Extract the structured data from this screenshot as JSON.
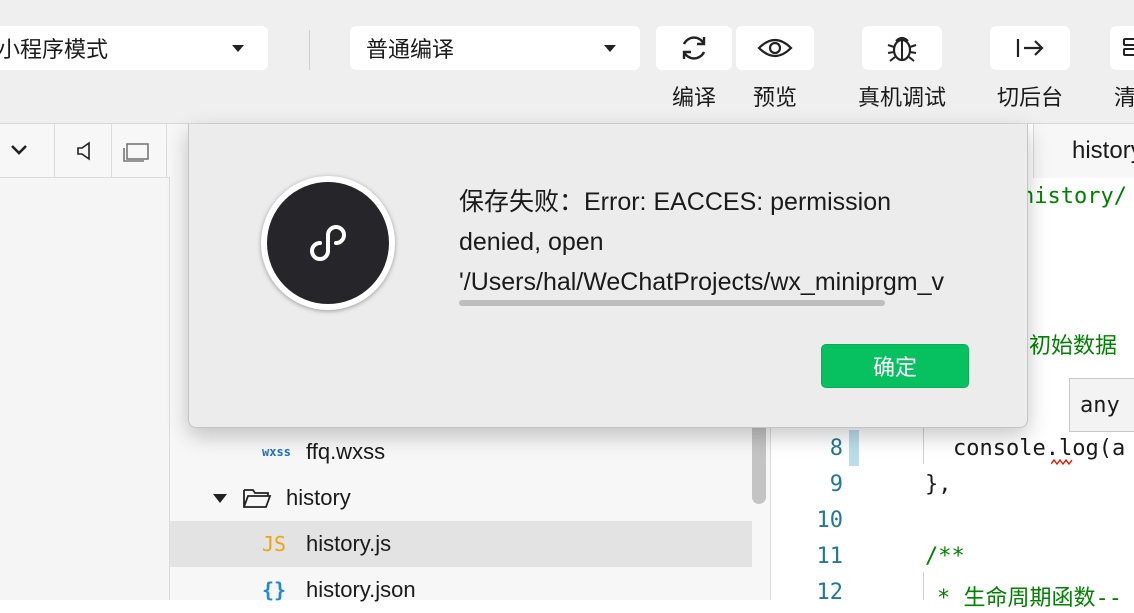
{
  "toolbar": {
    "mode_value": "小程序模式",
    "compile_value": "普通编译",
    "buttons": {
      "compile_label": "编译",
      "preview_label": "预览",
      "remote_debug_label": "真机调试",
      "background_label": "切后台",
      "clear_label": "清"
    }
  },
  "tree": {
    "items": [
      {
        "icon_text": "wxss",
        "label": "ffq.wxss"
      },
      {
        "label": "history"
      },
      {
        "icon_text": "JS",
        "label": "history.js"
      },
      {
        "icon_text": "{}",
        "label": "history.json"
      }
    ]
  },
  "editor": {
    "tab_label": "history",
    "lines": [
      {
        "text": "history/"
      },
      {
        "text": "的初始数据"
      },
      {
        "text": "any"
      },
      {
        "num": "8",
        "text": "console.log(a"
      },
      {
        "num": "9",
        "text": "},"
      },
      {
        "num": "10",
        "text": ""
      },
      {
        "num": "11",
        "text": "/**"
      },
      {
        "num": "12",
        "text": "* 生命周期函数--"
      }
    ]
  },
  "dialog": {
    "message_line1": "保存失败：Error: EACCES: permission",
    "message_line2": "denied, open",
    "message_line3": "'/Users/hal/WeChatProjects/wx_miniprgm_v",
    "ok_label": "确定"
  },
  "colors": {
    "ok_button": "#07c160",
    "comment_green": "#008000",
    "line_number": "#237893",
    "tree_icon_js": "#f0a30a",
    "tree_icon_json": "#1f8ad2",
    "tree_icon_wxss": "#1f6fc2"
  }
}
